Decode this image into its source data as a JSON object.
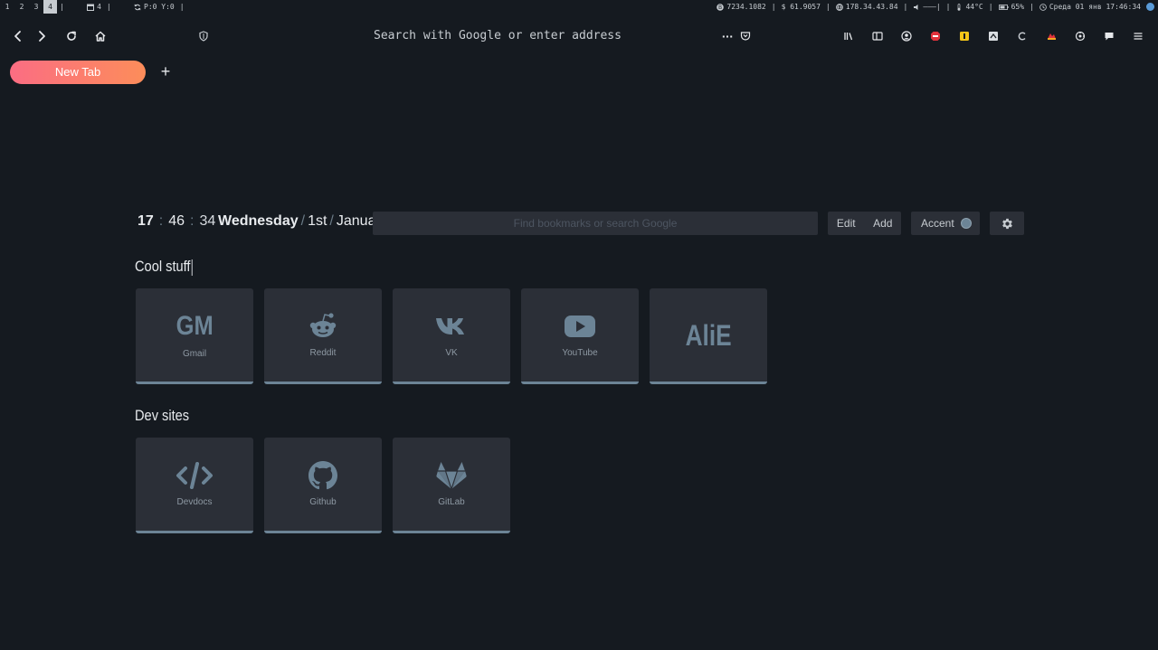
{
  "sysbar": {
    "workspaces": [
      "1",
      "2",
      "3",
      "4"
    ],
    "active_workspace": "4",
    "layout_icon": "calendar-icon",
    "layout_count": "4",
    "sync_status": "P:0 Y:0",
    "right": {
      "btc": "7234.1082",
      "usd": "61.9057",
      "ip": "178.34.43.84",
      "volume": "———|",
      "temp": "44°C",
      "battery": "65%",
      "datetime": "Среда 01 янв 17:46:34"
    }
  },
  "navbar": {
    "url_placeholder": "Search with Google or enter address",
    "more_glyph": "···"
  },
  "tab": {
    "label": "New Tab",
    "new_tab_glyph": "+"
  },
  "dashboard": {
    "clock": {
      "hours": "17",
      "minutes": "46",
      "seconds": "34",
      "separator": ":"
    },
    "date": {
      "weekday": "Wednesday",
      "day": "1st",
      "month": "January",
      "separator": "/"
    },
    "search_placeholder": "Find bookmarks or search Google",
    "edit_label": "Edit",
    "add_label": "Add",
    "accent_label": "Accent",
    "accent_color": "#6c8496"
  },
  "groups": [
    {
      "title": "Cool stuff",
      "items": [
        {
          "label": "Gmail",
          "letters": "GM",
          "icon": "gmail-letters"
        },
        {
          "label": "Reddit",
          "icon": "reddit-icon"
        },
        {
          "label": "VK",
          "icon": "vk-icon"
        },
        {
          "label": "YouTube",
          "icon": "youtube-icon"
        },
        {
          "label": "",
          "letters": "AliE",
          "icon": "aliexpress-letters"
        }
      ]
    },
    {
      "title": "Dev sites",
      "items": [
        {
          "label": "Devdocs",
          "icon": "code-icon"
        },
        {
          "label": "Github",
          "icon": "github-icon"
        },
        {
          "label": "GitLab",
          "icon": "gitlab-icon"
        }
      ]
    }
  ],
  "colors": {
    "background": "#151a20",
    "tile": "#2b2f37",
    "accent": "#6c8496",
    "tab_gradient_start": "#fb6d83",
    "tab_gradient_end": "#fc8d5a"
  }
}
